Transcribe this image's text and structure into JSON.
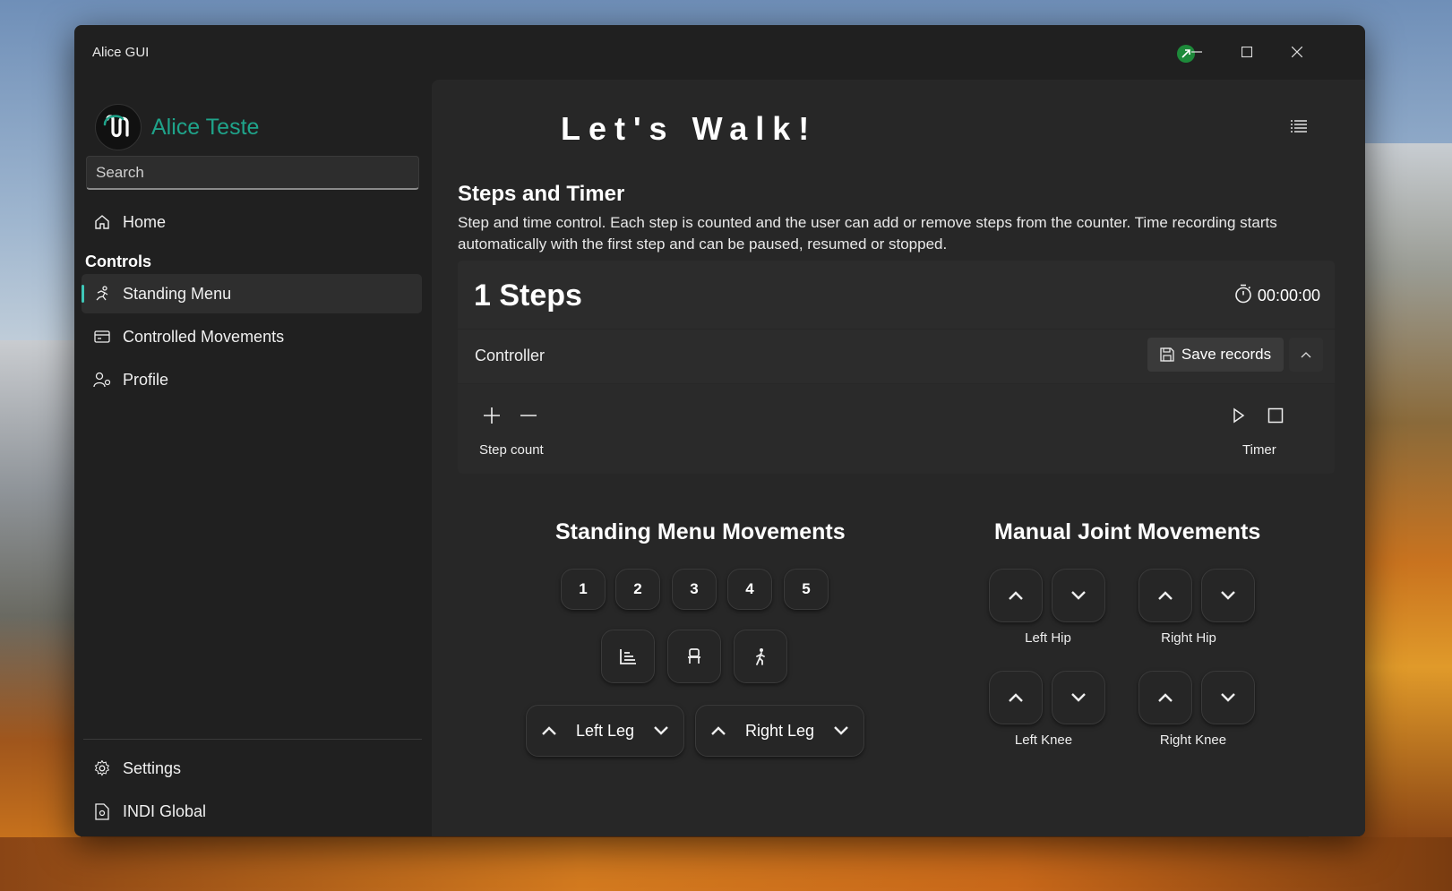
{
  "window": {
    "title": "Alice GUI"
  },
  "sidebar": {
    "brand_name": "Alice Teste",
    "search_placeholder": "Search",
    "home_label": "Home",
    "section_label": "Controls",
    "items": [
      {
        "label": "Standing Menu",
        "icon": "running-icon",
        "selected": true
      },
      {
        "label": "Controlled Movements",
        "icon": "card-icon",
        "selected": false
      },
      {
        "label": "Profile",
        "icon": "person-icon",
        "selected": false
      }
    ],
    "footer": [
      {
        "label": "Settings",
        "icon": "gear-icon"
      },
      {
        "label": "INDI Global",
        "icon": "document-icon"
      }
    ]
  },
  "main": {
    "page_title": "Let's Walk!",
    "section_title": "Steps and Timer",
    "section_desc": "Step and time control. Each step is counted and the user can add or remove steps from the counter. Time recording starts automatically with the first step and can be paused, resumed or stopped.",
    "steps_text": "1 Steps",
    "timer_value": "00:00:00",
    "controller_label": "Controller",
    "save_label": "Save records",
    "step_count_label": "Step count",
    "timer_label": "Timer",
    "standing": {
      "title": "Standing Menu Movements",
      "numbers": [
        "1",
        "2",
        "3",
        "4",
        "5"
      ],
      "actions": [
        "sit-chart-icon",
        "chair-icon",
        "walk-icon"
      ],
      "left_leg": "Left Leg",
      "right_leg": "Right Leg"
    },
    "manual": {
      "title": "Manual Joint Movements",
      "joints": [
        "Left Hip",
        "Right Hip",
        "Left Knee",
        "Right Knee"
      ]
    }
  },
  "colors": {
    "accent": "#3fc7b8",
    "brand": "#1fa38a",
    "connection": "#1d8a3a"
  }
}
